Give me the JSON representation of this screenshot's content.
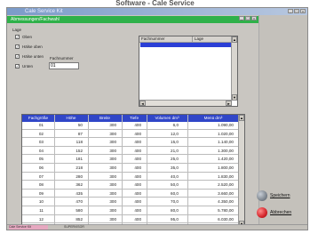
{
  "caption": "Software - Cale Service",
  "window": {
    "title": "Cale Service Kit",
    "min": "_",
    "max": "□",
    "close": "x"
  },
  "form": {
    "title": "Abmessungen/Fachwahl"
  },
  "options": {
    "section": "Lage",
    "items": [
      {
        "label": "Oben",
        "checked": true
      },
      {
        "label": "Hälse oben",
        "checked": true
      },
      {
        "label": "Hälse unten",
        "checked": true
      },
      {
        "label": "Unten",
        "checked": true
      }
    ],
    "fach_label": "Fachnummer",
    "fach_value": "01"
  },
  "list": {
    "col1": "Fachnummer",
    "col2": "Lage"
  },
  "scroll": {
    "up": "▲",
    "down": "▼",
    "left": "◄",
    "right": "►"
  },
  "grid": {
    "headers": [
      "Fachgröße",
      "Höhe",
      "Breite",
      "Tiefe",
      "Volumen dm³",
      "Menü dm³"
    ],
    "rows": [
      [
        "01",
        "50",
        "300",
        "400",
        "6,0",
        "1.090,00"
      ],
      [
        "02",
        "87",
        "300",
        "400",
        "12,0",
        "1.020,00"
      ],
      [
        "03",
        "118",
        "300",
        "400",
        "15,0",
        "1.140,00"
      ],
      [
        "04",
        "152",
        "300",
        "400",
        "21,0",
        "1.300,00"
      ],
      [
        "05",
        "181",
        "300",
        "400",
        "25,0",
        "1.420,00"
      ],
      [
        "06",
        "218",
        "300",
        "400",
        "35,0",
        "1.800,00"
      ],
      [
        "07",
        "280",
        "300",
        "400",
        "40,0",
        "1.830,00"
      ],
      [
        "08",
        "362",
        "300",
        "400",
        "50,0",
        "2.520,00"
      ],
      [
        "09",
        "435",
        "300",
        "400",
        "60,0",
        "3.660,00"
      ],
      [
        "10",
        "470",
        "300",
        "400",
        "70,0",
        "4.350,00"
      ],
      [
        "11",
        "580",
        "300",
        "400",
        "80,0",
        "5.780,00"
      ],
      [
        "12",
        "852",
        "300",
        "400",
        "95,0",
        "6.030,00"
      ]
    ]
  },
  "actions": {
    "save": "Speichern",
    "cancel": "Abbrechen"
  },
  "status": {
    "left": "Cale Service Kit",
    "right": "SUPERVISOR"
  },
  "colors": {
    "form_bar": "#2fb14a",
    "grid_header": "#3046c8",
    "selection": "#2b3fd6",
    "save_button": "#7f8790",
    "cancel_button": "#d3242a"
  }
}
